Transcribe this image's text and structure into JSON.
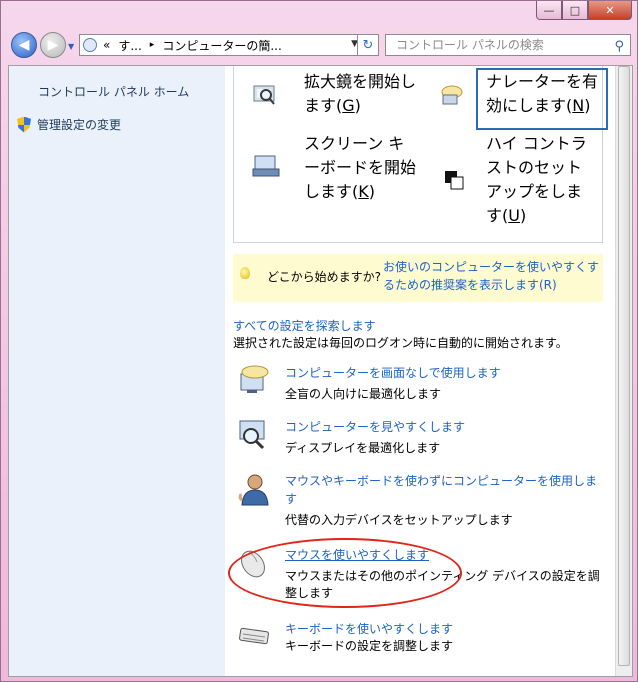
{
  "window": {
    "controls": [
      "—",
      "□",
      "✕"
    ]
  },
  "nav": {
    "address_segments": [
      "«",
      "す...",
      "▸",
      "コンピューターの簡..."
    ],
    "search_placeholder": "コントロール パネルの検索"
  },
  "sidebar": {
    "home_link": "コントロール パネル ホーム",
    "admin_link": "管理設定の変更"
  },
  "quick_tools": [
    {
      "lines": [
        "拡大鏡を開始し",
        "ます(",
        "G",
        ")"
      ],
      "id": "magnifier"
    },
    {
      "lines": [
        "ナレーターを有",
        "効にします(",
        "N",
        ")"
      ],
      "id": "narrator"
    },
    {
      "lines": [
        "スクリーン キ",
        "ーボードを開始",
        "します(",
        "K",
        ")"
      ],
      "id": "onscreen-keyboard"
    },
    {
      "lines": [
        "ハイ コントラ",
        "ストのセット",
        "アップをしま",
        "す(",
        "U",
        ")"
      ],
      "id": "high-contrast"
    }
  ],
  "tip": {
    "question": "どこから始めますか?",
    "link": "お使いのコンピューターを使いやすくするための推奨案を表示します(R)"
  },
  "explore": {
    "title": "すべての設定を探索します",
    "description": "選択された設定は毎回のログオン時に自動的に開始されます。"
  },
  "items": [
    {
      "icon": "monitor-balloon-icon",
      "link": "コンピューターを画面なしで使用します",
      "desc": "全盲の人向けに最適化します"
    },
    {
      "icon": "monitor-magnifier-icon",
      "link": "コンピューターを見やすくします",
      "desc": "ディスプレイを最適化します"
    },
    {
      "icon": "person-icon",
      "link": "マウスやキーボードを使わずにコンピューターを使用します",
      "desc": "代替の入力デバイスをセットアップします"
    },
    {
      "icon": "mouse-icon",
      "link": "マウスを使いやすくします",
      "desc": "マウスまたはその他のポインティング デバイスの設定を調整します"
    },
    {
      "icon": "keyboard-icon",
      "link": "キーボードを使いやすくします",
      "desc": "キーボードの設定を調整します"
    }
  ]
}
